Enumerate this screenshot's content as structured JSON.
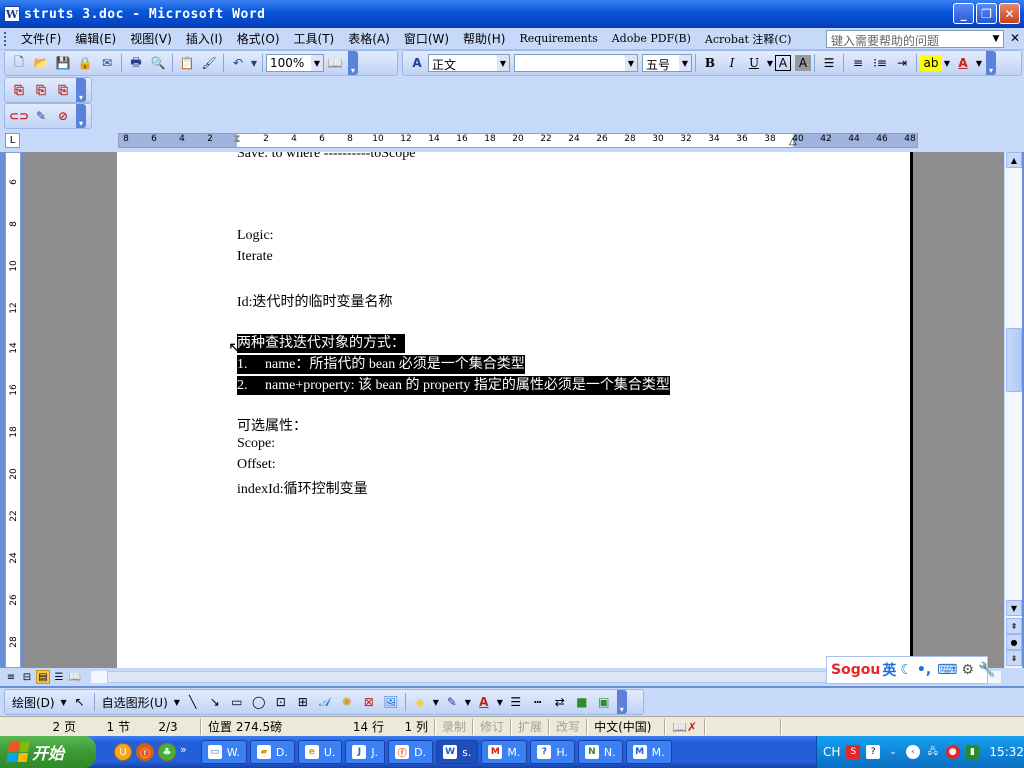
{
  "window": {
    "title": "struts 3.doc - Microsoft Word",
    "app_icon": "W",
    "buttons": {
      "minimize": "_",
      "maximize": "❐",
      "close": "✕"
    }
  },
  "menubar": {
    "items": [
      "文件(F)",
      "编辑(E)",
      "视图(V)",
      "插入(I)",
      "格式(O)",
      "工具(T)",
      "表格(A)",
      "窗口(W)",
      "帮助(H)",
      "Requirements",
      "Adobe PDF(B)",
      "Acrobat 注释(C)"
    ],
    "help_placeholder": "键入需要帮助的问题",
    "close_glyph": "✕"
  },
  "toolbar": {
    "zoom": "100%",
    "style": "正文",
    "font": "",
    "size": "五号",
    "bold": "B",
    "italic": "I",
    "underline": "U",
    "char_border": "A",
    "char_shading": "A"
  },
  "ruler": {
    "numbers": [
      8,
      6,
      4,
      2,
      2,
      4,
      6,
      8,
      10,
      12,
      14,
      16,
      18,
      20,
      22,
      24,
      26,
      28,
      30,
      32,
      34,
      36,
      38,
      40,
      42,
      44,
      46,
      48
    ],
    "vertical_numbers": [
      6,
      8,
      10,
      12,
      14,
      16,
      18,
      20,
      22,
      24,
      26,
      28
    ],
    "tab_glyph": "L"
  },
  "document": {
    "lines": [
      {
        "text": "Save: to where ----------toScope",
        "highlight": false
      },
      {
        "text": "Logic:",
        "highlight": false
      },
      {
        "text": "Iterate",
        "highlight": false
      },
      {
        "text": "Id:迭代时的临时变量名称",
        "highlight": false
      },
      {
        "text": "两种查找迭代对象的方式：",
        "highlight": true
      },
      {
        "text": "1.     name：所指代的 bean 必须是一个集合类型",
        "highlight": true
      },
      {
        "text": "2.     name+property: 该 bean 的 property 指定的属性必须是一个集合类型",
        "highlight": true
      },
      {
        "text": "可选属性：",
        "highlight": false
      },
      {
        "text": "Scope:",
        "highlight": false
      },
      {
        "text": "Offset:",
        "highlight": false
      },
      {
        "text": "indexId:循环控制变量",
        "highlight": false
      }
    ]
  },
  "sogou": {
    "brand": "Sogou",
    "mode": "英"
  },
  "drawbar": {
    "draw_label": "绘图(D)",
    "autoshape_label": "自选图形(U)"
  },
  "status": {
    "page": "2 页",
    "section": "1 节",
    "page_of": "2/3",
    "position": "位置 274.5磅",
    "line": "14 行",
    "column": "1 列",
    "rec": "录制",
    "trk": "修订",
    "ext": "扩展",
    "ovr": "改写",
    "language": "中文(中国)"
  },
  "taskbar": {
    "start_label": "开始",
    "tasks": [
      "W.",
      "D.",
      "U.",
      "J.",
      "D.",
      "s.",
      "M.",
      "H.",
      "N.",
      "M."
    ],
    "tray_lang": "CH",
    "clock": "15:32"
  }
}
